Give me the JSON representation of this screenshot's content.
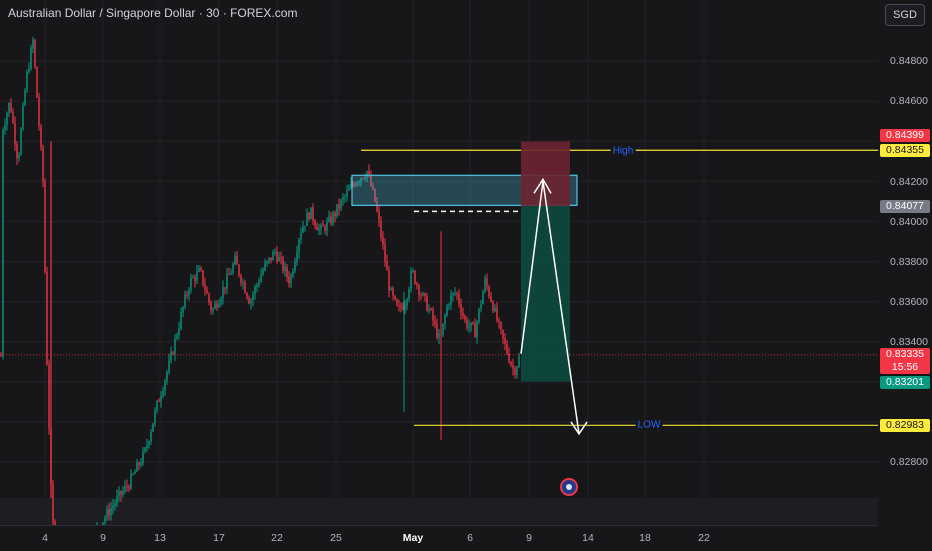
{
  "header": {
    "title": "Australian Dollar / Singapore Dollar · 30 · FOREX.com"
  },
  "currency": {
    "label": "SGD"
  },
  "price_axis": {
    "ticks": [
      "0.84800",
      "0.84600",
      "0.84200",
      "0.84000",
      "0.83800",
      "0.83600",
      "0.83400",
      "0.82800"
    ]
  },
  "badges": {
    "target_price": "0.84399",
    "high_price": "0.84355",
    "pending_price": "0.84077",
    "current_price": "0.83335",
    "countdown": "15:56",
    "stop_price": "0.83201",
    "low_price": "0.82983"
  },
  "line_labels": {
    "high": "High",
    "low": "LOW"
  },
  "time_axis": {
    "labels": [
      "4",
      "9",
      "13",
      "17",
      "22",
      "25",
      "May",
      "6",
      "9",
      "14",
      "18",
      "22"
    ]
  },
  "colors": {
    "up": "#089981",
    "down": "#f23645",
    "level_line": "#f0e130",
    "zone": "#4fc3e6",
    "profit": "#0d4a3f",
    "loss": "#6b2430"
  },
  "icons": {
    "flag": "australia-flag-icon"
  }
}
